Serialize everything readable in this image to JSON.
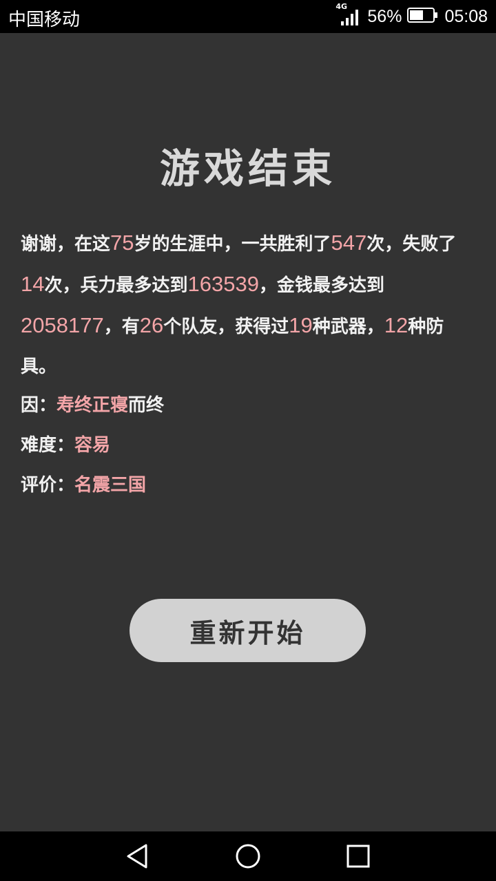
{
  "status_bar": {
    "carrier": "中国移动",
    "network_type": "4G",
    "battery_percent": "56%",
    "time": "05:08",
    "icons": [
      "signal-icon",
      "battery-icon"
    ]
  },
  "game_over": {
    "title": "游戏结束",
    "summary": {
      "p1": "谢谢，在这",
      "age": "75",
      "p2": "岁的生涯中，一共胜利了",
      "wins": "547",
      "p3": "次，失败了",
      "losses": "14",
      "p4": "次，兵力最多达到",
      "max_troops": "163539",
      "p5": "，金钱最多达到",
      "max_money": "2058177",
      "p6": "，有",
      "teammates": "26",
      "p7": "个队友，获得过",
      "weapons": "19",
      "p8": "种武器，",
      "armors": "12",
      "p9": "种防具。"
    },
    "cause": {
      "label": "因：",
      "value": "寿终正寝",
      "suffix": "而终"
    },
    "difficulty": {
      "label": "难度：",
      "value": "容易"
    },
    "rating": {
      "label": "评价：",
      "value": "名震三国"
    },
    "restart_label": "重新开始"
  },
  "nav_bar": {
    "icons": [
      "back-icon",
      "home-icon",
      "recents-icon"
    ]
  },
  "colors": {
    "background": "#333333",
    "highlight": "#f3a5a8",
    "button": "#d2d2d2"
  }
}
